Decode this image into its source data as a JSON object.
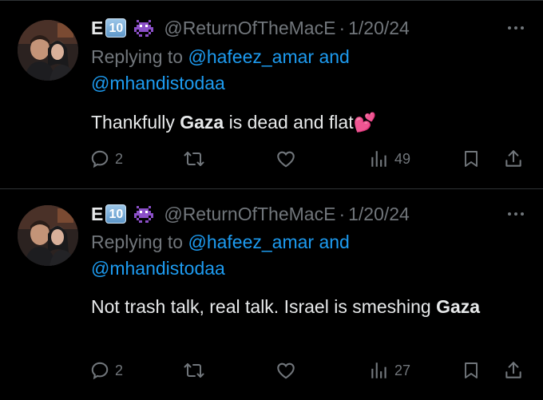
{
  "tweets": [
    {
      "name": "E",
      "name_badge": "10",
      "handle": "@ReturnOfTheMacE",
      "dot": "·",
      "date": "1/20/24",
      "replying_prefix": "Replying to",
      "replying_to_1": "@hafeez_amar",
      "replying_and": "and",
      "replying_to_2": "@mhandistodaa",
      "text_before": "Thankfully ",
      "text_bold": "Gaza",
      "text_after": " is dead and flat",
      "text_emoji": "💕",
      "replies": "2",
      "retweets": "",
      "likes": "",
      "views": "49"
    },
    {
      "name": "E",
      "name_badge": "10",
      "handle": "@ReturnOfTheMacE",
      "dot": "·",
      "date": "1/20/24",
      "replying_prefix": "Replying to",
      "replying_to_1": "@hafeez_amar",
      "replying_and": "and",
      "replying_to_2": "@mhandistodaa",
      "text_before": "Not trash talk, real talk. Israel is smeshing ",
      "text_bold": "Gaza",
      "text_after": "",
      "text_emoji": "",
      "replies": "2",
      "retweets": "",
      "likes": "",
      "views": "27"
    }
  ],
  "icons": {
    "reply": "reply-icon",
    "retweet": "retweet-icon",
    "like": "heart-icon",
    "views": "views-icon",
    "bookmark": "bookmark-icon",
    "share": "share-icon",
    "more": "more-icon",
    "alien": "alien-monster-icon"
  },
  "colors": {
    "background": "#000000",
    "text": "#e7e9ea",
    "muted": "#71767b",
    "link": "#1d9bf0",
    "divider": "#2f3336"
  }
}
